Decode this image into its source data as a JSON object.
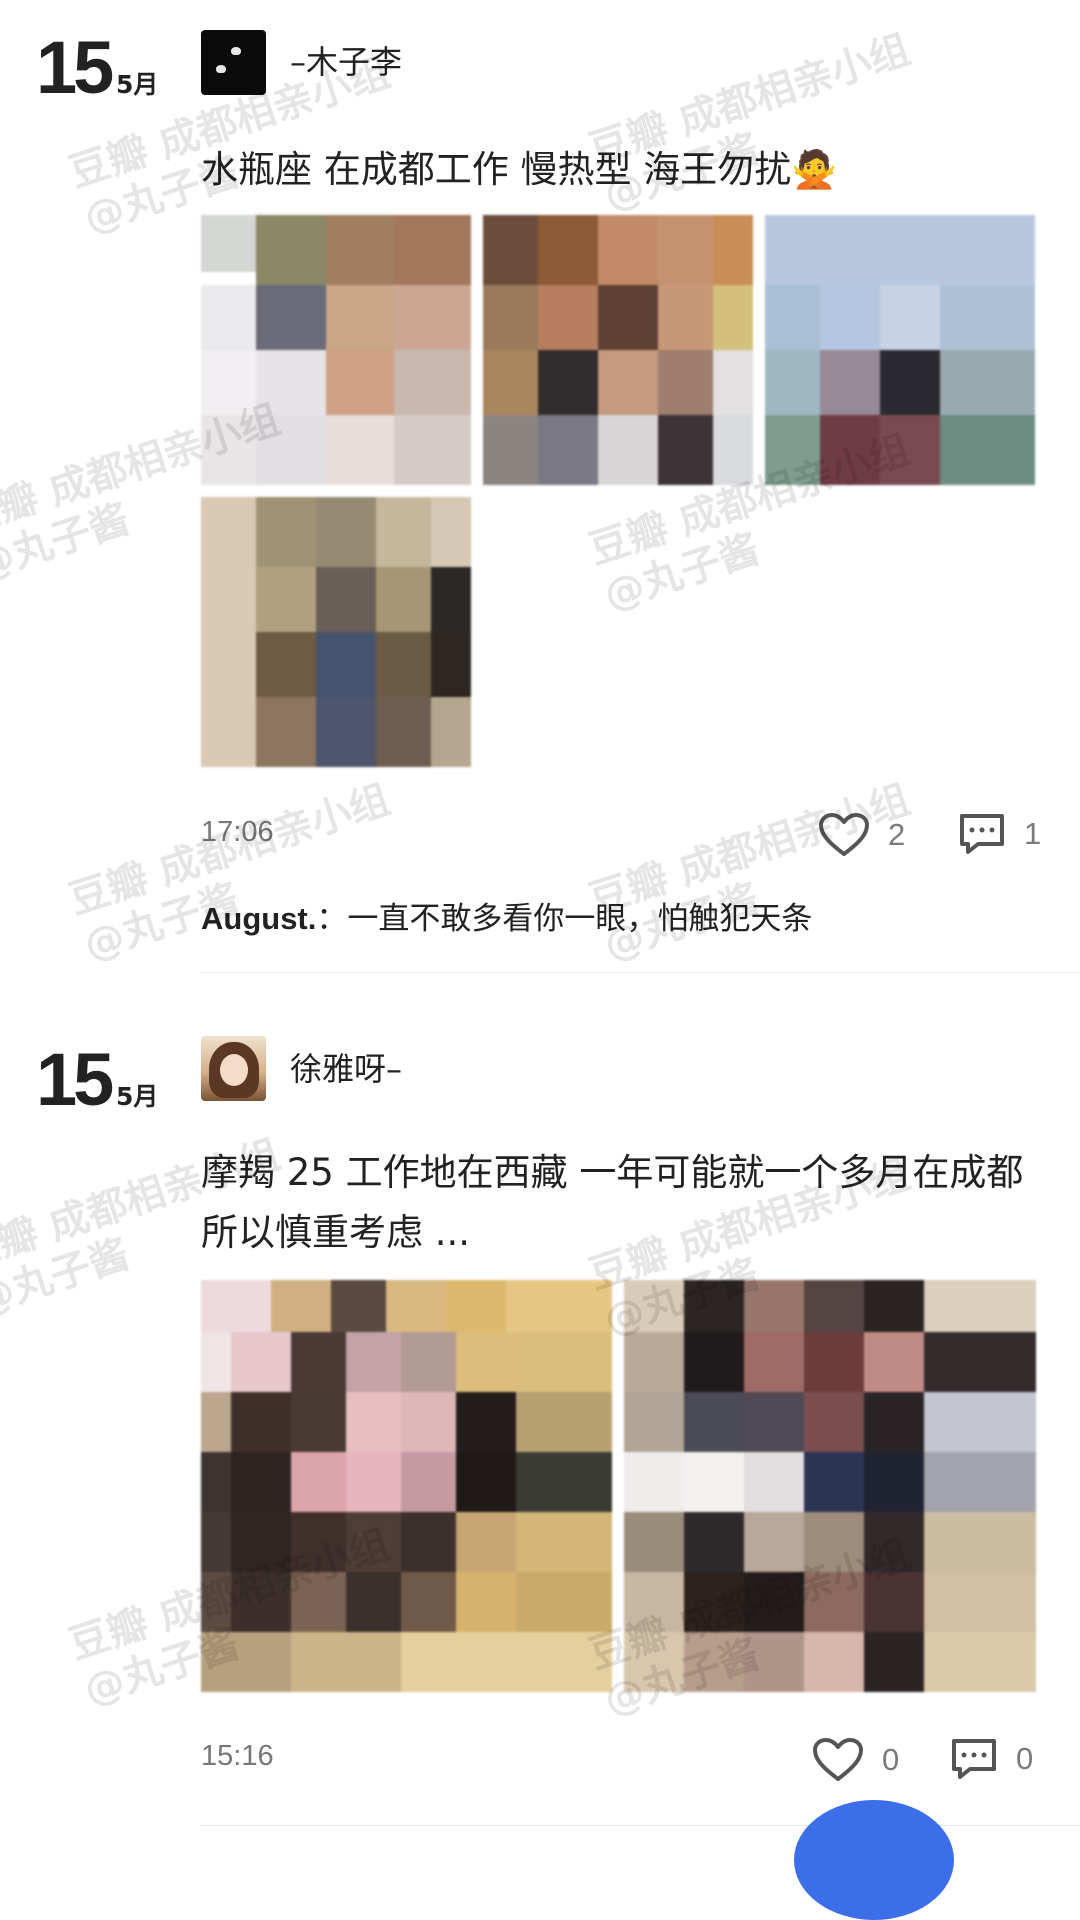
{
  "posts": [
    {
      "date_day": "15",
      "date_month": "5月",
      "username": "–木子李",
      "text": "水瓶座 在成都工作 慢热型 海王勿扰🙅",
      "time": "17:06",
      "likes": "2",
      "comments": "1",
      "comment_preview": {
        "author": "August.",
        "separator": "：",
        "text": "一直不敢多看你一眼，怕触犯天条"
      }
    },
    {
      "date_day": "15",
      "date_month": "5月",
      "username": "徐雅呀–",
      "text": "摩羯 25 工作地在西藏 一年可能就一个多月在成都 所以慎重考虑 ...",
      "time": "15:16",
      "likes": "0",
      "comments": "0"
    }
  ],
  "watermark": {
    "line1": "豆瓣 成都相亲小组",
    "line2": "@丸子酱"
  },
  "icons": {
    "like": "heart-icon",
    "comment": "comment-icon"
  },
  "colors": {
    "accent_blue": "#3b6ee8",
    "text": "#222222",
    "meta": "#777777"
  }
}
